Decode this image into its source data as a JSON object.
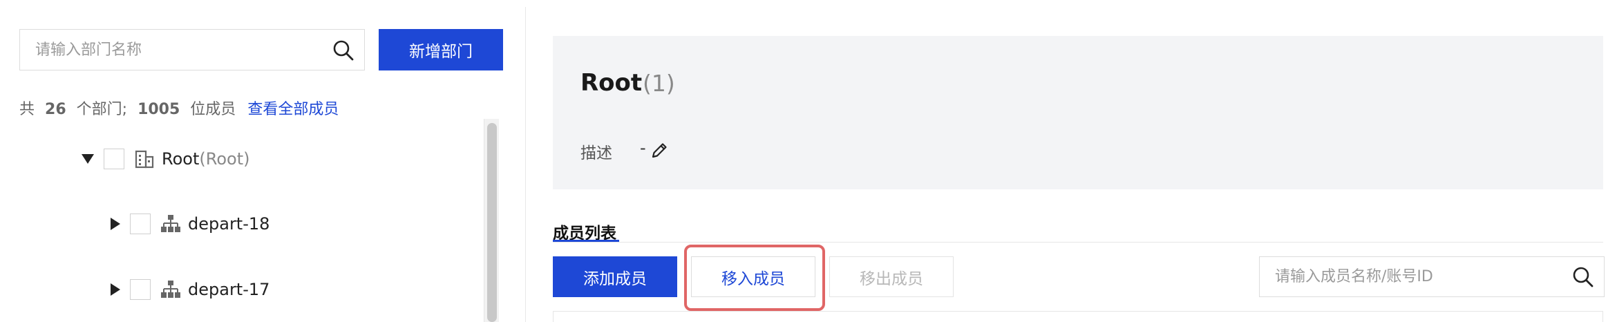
{
  "left_panel": {
    "search_placeholder": "请输入部门名称",
    "add_department_label": "新增部门",
    "summary": {
      "prefix": "共",
      "dept_count": "26",
      "dept_unit": "个部门;",
      "member_count": "1005",
      "member_unit": "位成员",
      "view_all_link": "查看全部成员"
    },
    "tree": [
      {
        "label": "Root",
        "sub": "(Root)",
        "expanded": true,
        "icon": "building-icon"
      },
      {
        "label": "depart-18",
        "expanded": false,
        "icon": "org-chart-icon"
      },
      {
        "label": "depart-17",
        "expanded": false,
        "icon": "org-chart-icon"
      }
    ]
  },
  "detail": {
    "title": "Root",
    "count": "(1)",
    "description_label": "描述",
    "description_value": "-"
  },
  "members": {
    "tab_label": "成员列表",
    "add_member_label": "添加成员",
    "move_in_label": "移入成员",
    "move_out_label": "移出成员",
    "search_placeholder": "请输入成员名称/账号ID"
  },
  "colors": {
    "primary": "#1e48d6",
    "highlight": "#e06666",
    "card_bg": "#f3f4f6"
  }
}
